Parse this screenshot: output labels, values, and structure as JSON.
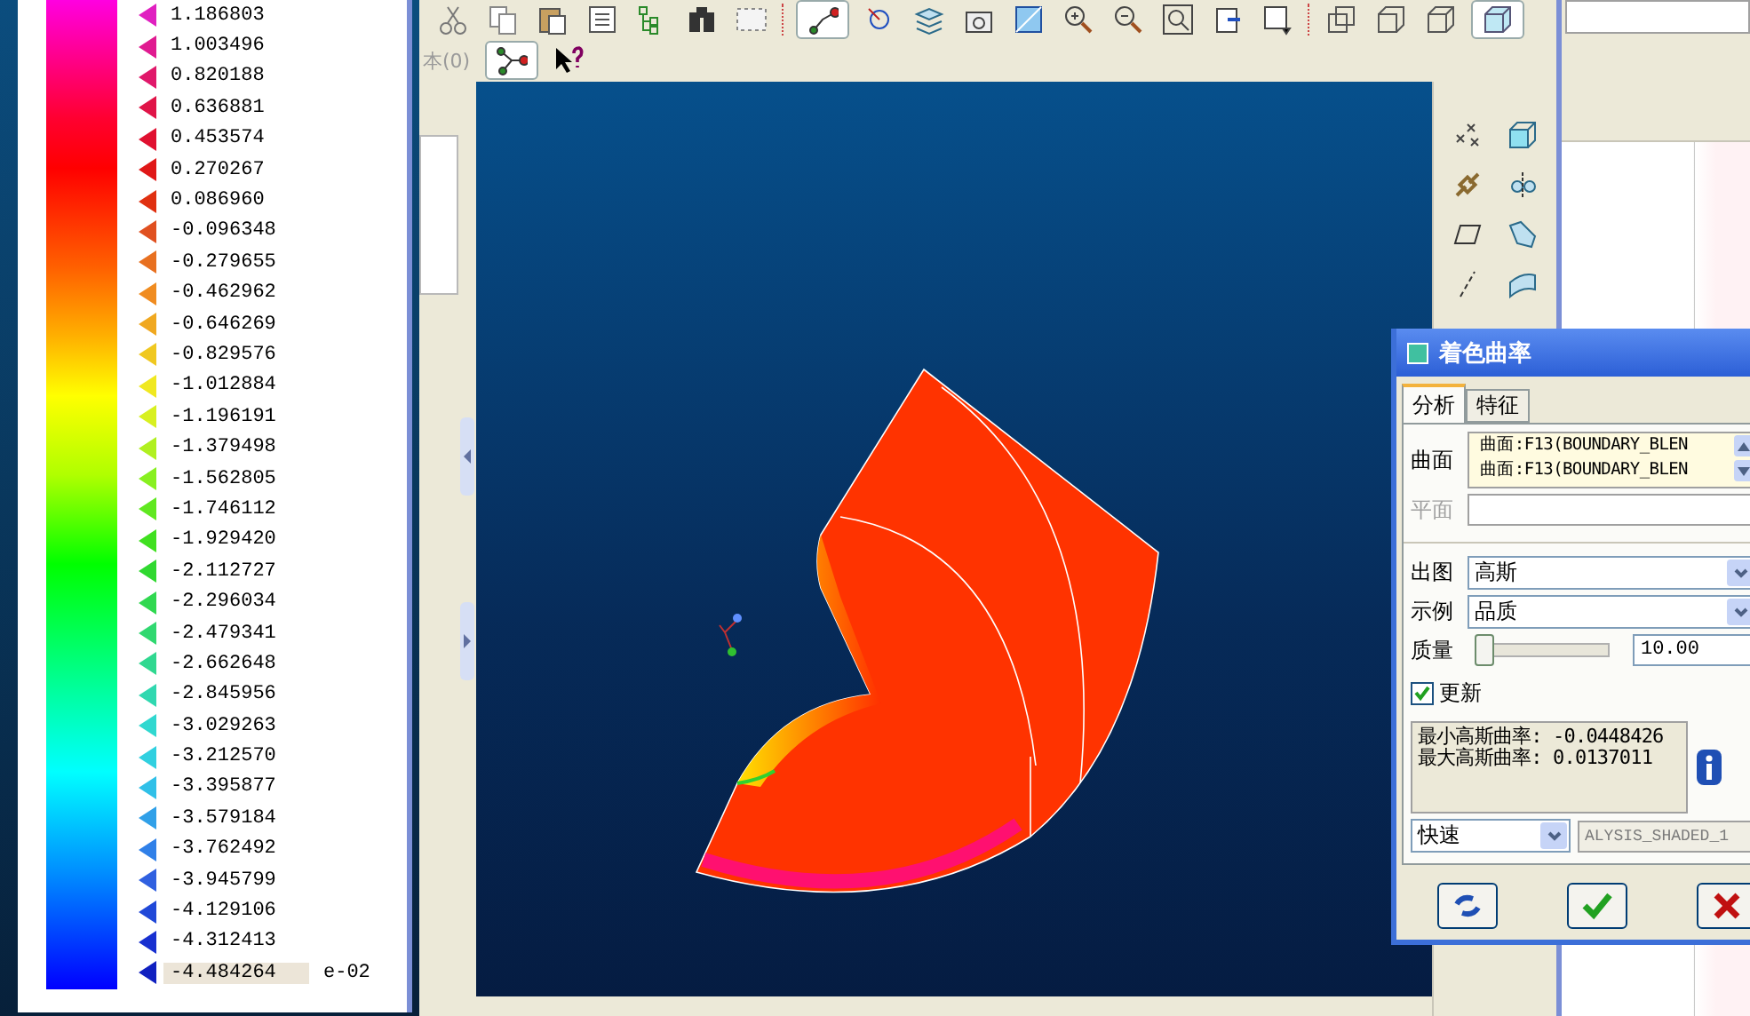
{
  "legend": {
    "entries": [
      {
        "value": "1.186803",
        "color": "#e020c0",
        "selected": false
      },
      {
        "value": "1.003496",
        "color": "#e01a90",
        "selected": false
      },
      {
        "value": "0.820188",
        "color": "#e0186a",
        "selected": false
      },
      {
        "value": "0.636881",
        "color": "#e01448",
        "selected": false
      },
      {
        "value": "0.453574",
        "color": "#e01030",
        "selected": false
      },
      {
        "value": "0.270267",
        "color": "#e01818",
        "selected": false
      },
      {
        "value": "0.086960",
        "color": "#e03010",
        "selected": false
      },
      {
        "value": "-0.096348",
        "color": "#e05020",
        "selected": false
      },
      {
        "value": "-0.279655",
        "color": "#e87020",
        "selected": false
      },
      {
        "value": "-0.462962",
        "color": "#f08c20",
        "selected": false
      },
      {
        "value": "-0.646269",
        "color": "#f0a820",
        "selected": false
      },
      {
        "value": "-0.829576",
        "color": "#f0c820",
        "selected": false
      },
      {
        "value": "-1.012884",
        "color": "#f0e820",
        "selected": false
      },
      {
        "value": "-1.196191",
        "color": "#d8f020",
        "selected": false
      },
      {
        "value": "-1.379498",
        "color": "#b0f020",
        "selected": false
      },
      {
        "value": "-1.562805",
        "color": "#88f020",
        "selected": false
      },
      {
        "value": "-1.746112",
        "color": "#60e820",
        "selected": false
      },
      {
        "value": "-1.929420",
        "color": "#40e020",
        "selected": false
      },
      {
        "value": "-2.112727",
        "color": "#30d830",
        "selected": false
      },
      {
        "value": "-2.296034",
        "color": "#30d850",
        "selected": false
      },
      {
        "value": "-2.479341",
        "color": "#30d870",
        "selected": false
      },
      {
        "value": "-2.662648",
        "color": "#30d890",
        "selected": false
      },
      {
        "value": "-2.845956",
        "color": "#30d8b0",
        "selected": false
      },
      {
        "value": "-3.029263",
        "color": "#30d8d0",
        "selected": false
      },
      {
        "value": "-3.212570",
        "color": "#30d0e0",
        "selected": false
      },
      {
        "value": "-3.395877",
        "color": "#30c0e8",
        "selected": false
      },
      {
        "value": "-3.579184",
        "color": "#30a0e8",
        "selected": false
      },
      {
        "value": "-3.762492",
        "color": "#3080e8",
        "selected": false
      },
      {
        "value": "-3.945799",
        "color": "#3060e0",
        "selected": false
      },
      {
        "value": "-4.129106",
        "color": "#2048d8",
        "selected": false
      },
      {
        "value": "-4.312413",
        "color": "#1830d0",
        "selected": false
      },
      {
        "value": "-4.484264",
        "color": "#1020c0",
        "selected": true
      }
    ],
    "exponent": "e-02"
  },
  "toolbar": {
    "row_label": "本(0)"
  },
  "dialog": {
    "title": "着色曲率",
    "tabs": [
      {
        "label": "分析",
        "selected": true
      },
      {
        "label": "特征",
        "selected": false
      }
    ],
    "surface": {
      "label": "曲面",
      "items": [
        "曲面:F13(BOUNDARY_BLEN",
        "曲面:F13(BOUNDARY_BLEN"
      ]
    },
    "plane": {
      "label": "平面",
      "disabled": true
    },
    "output": {
      "label": "出图",
      "value": "高斯"
    },
    "sample": {
      "label": "示例",
      "value": "品质"
    },
    "quality": {
      "label": "质量",
      "level": 0.05,
      "value": "10.00"
    },
    "update": {
      "label": "更新",
      "checked": true
    },
    "results": [
      "最小高斯曲率: -0.0448426",
      "最大高斯曲率: 0.0137011"
    ],
    "mode": {
      "value": "快速"
    },
    "name_field": {
      "value": "ALYSIS_SHADED_1",
      "disabled": true
    }
  }
}
